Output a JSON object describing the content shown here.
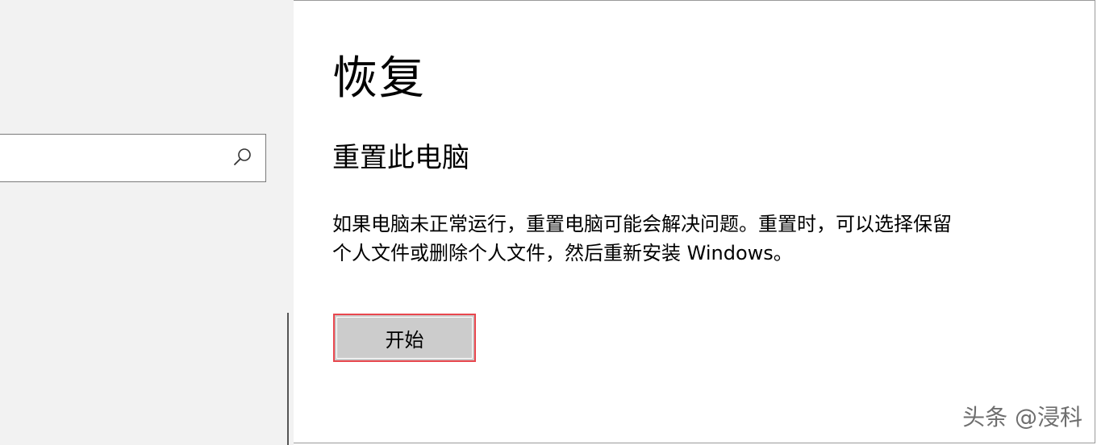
{
  "sidebar": {
    "search": {
      "value": "",
      "placeholder": ""
    }
  },
  "main": {
    "page_title": "恢复",
    "section_title": "重置此电脑",
    "description": "如果电脑未正常运行，重置电脑可能会解决问题。重置时，可以选择保留个人文件或删除个人文件，然后重新安装 Windows。",
    "start_button_label": "开始"
  },
  "watermark": "头条 @浸科",
  "colors": {
    "sidebar_bg": "#f2f2f2",
    "button_bg": "#cccccc",
    "highlight_border": "#e8474e"
  },
  "icons": {
    "search": "search-icon"
  }
}
